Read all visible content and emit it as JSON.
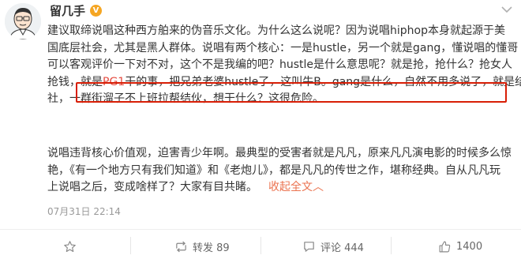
{
  "post": {
    "username": "留几手",
    "verified_label": "V",
    "paragraph1": [
      "建议取缔说唱这种西方舶来的伪音乐文化。为什么这么说呢？因为说唱hiphop本身就起源于美",
      "国底层社会，尤其是黑人群体。说唱有两个核心：一是hustle，另一个就是gang，懂说唱的懂哥",
      "可以客观评价一下对不对，这个不是我编的吧？hustle是什么意思呢？就是抢，抢什么？抢女人",
      "抢钱，",
      "社，一群街溜子不上班拉帮结伙，想干什么？这很危险。"
    ],
    "highlight": {
      "prefix": "就是",
      "pg1": "PG1",
      "rest": "干的事，把兄弟老婆hustle了，这叫牛B。gang是什么，自然不用多说了，就是结"
    },
    "paragraph2": [
      "说唱违背核心价值观，迫害青少年啊。最典型的受害者就是凡凡，原来凡凡演电影的时候多么惊",
      "艳，《有一个地方只有我们知道》和《老炮儿》，都是凡凡的传世之作，堪称经典。自从凡凡玩",
      "上说唱之后，变成啥样了？大家有目共睹。"
    ],
    "collapse_link": "收起全文",
    "collapse_arrow": "︿",
    "timestamp": "07月31日 22:14"
  },
  "actions": {
    "repost_label": "转发 89",
    "comment_label": "评论 444",
    "like_count": "1400"
  },
  "colors": {
    "highlight_border": "#d81e06",
    "pg1_text": "#e54d42",
    "link": "#eb7350",
    "verified_badge": "#f5a623"
  }
}
